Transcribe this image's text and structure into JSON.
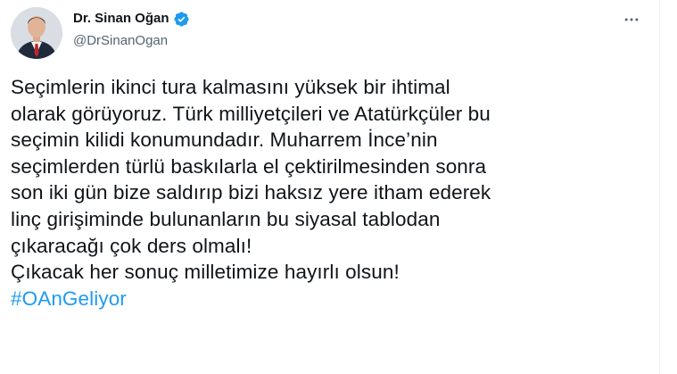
{
  "tweet": {
    "author": {
      "display_name": "Dr. Sinan Oğan",
      "handle": "@DrSinanOgan",
      "avatar_icon": "profile-photo",
      "verified_icon": "verified-badge-icon",
      "verified_color": "#1d9bf0"
    },
    "more_icon": "ellipsis-icon",
    "text_lines": [
      "Seçimlerin ikinci tura kalmasını yüksek bir ihtimal",
      "olarak görüyoruz. Türk milliyetçileri ve Atatürkçüler bu",
      "seçimin kilidi konumundadır. Muharrem İnce’nin",
      "seçimlerden türlü baskılarla el çektirilmesinden sonra",
      "son iki gün bize saldırıp bizi haksız yere itham ederek",
      "linç girişiminde bulunanların bu siyasal tablodan",
      "çıkaracağı çok ders olmalı!",
      "Çıkacak her sonuç milletimize hayırlı olsun!"
    ],
    "hashtag": "#OAnGeliyor",
    "hashtag_color": "#1d9bf0"
  }
}
